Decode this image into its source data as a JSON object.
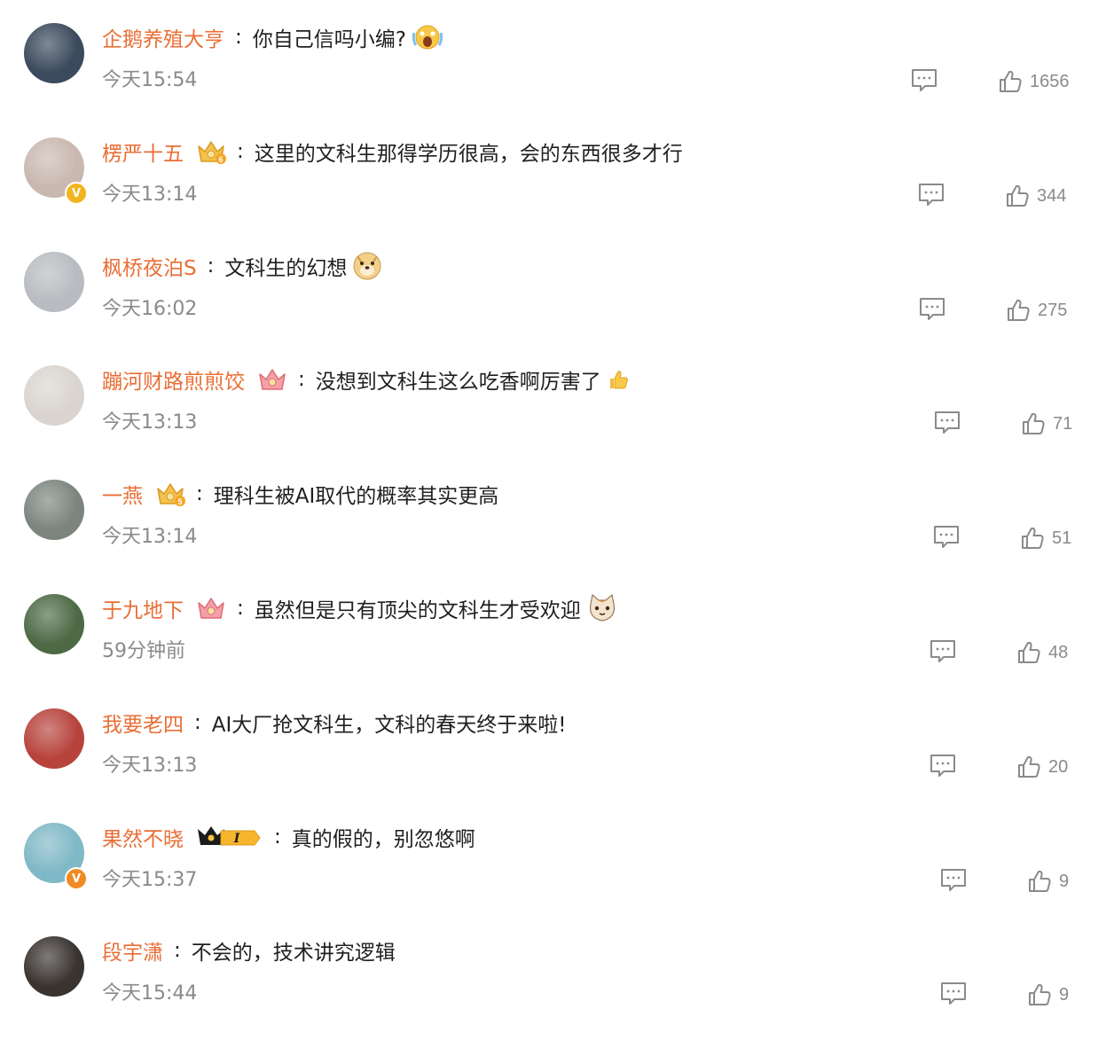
{
  "comments": [
    {
      "user": "企鹅养殖大亨",
      "text": "你自己信吗小编?",
      "time": "今天15:54",
      "likes": "1656",
      "verified": false,
      "crown": "none",
      "emoji": "scream-emoji",
      "avatar_color": "#3b4a5c"
    },
    {
      "user": "楞严十五",
      "text": "这里的文科生那得学历很高，会的东西很多才行",
      "time": "今天13:14",
      "likes": "344",
      "verified": true,
      "verified_color": "#f2b51d",
      "crown": "gold-crown-6",
      "emoji": "",
      "avatar_color": "#c9b8b0"
    },
    {
      "user": "枫桥夜泊S",
      "text": "文科生的幻想",
      "time": "今天16:02",
      "likes": "275",
      "verified": false,
      "crown": "none",
      "emoji": "doge-emoji",
      "avatar_color": "#b8bcc0"
    },
    {
      "user": "蹦河财路煎煎饺",
      "text": "没想到文科生这么吃香啊厉害了",
      "time": "今天13:13",
      "likes": "71",
      "verified": false,
      "crown": "pink-crown",
      "emoji": "thumbs-up-emoji",
      "avatar_color": "#d9d4cf"
    },
    {
      "user": "一燕",
      "text": "理科生被AI取代的概率其实更高",
      "time": "今天13:14",
      "likes": "51",
      "verified": false,
      "crown": "gold-crown-5",
      "emoji": "",
      "avatar_color": "#7b857e"
    },
    {
      "user": "于九地下",
      "text": "虽然但是只有顶尖的文科生才受欢迎",
      "time": "59分钟前",
      "likes": "48",
      "verified": false,
      "crown": "pink-crown",
      "emoji": "cat-emoji",
      "avatar_color": "#4d6a45"
    },
    {
      "user": "我要老四",
      "text": "AI大厂抢文科生，文科的春天终于来啦!",
      "time": "今天13:13",
      "likes": "20",
      "verified": false,
      "crown": "none",
      "emoji": "",
      "avatar_color": "#b8433d"
    },
    {
      "user": "果然不晓",
      "text": "真的假的，别忽悠啊",
      "time": "今天15:37",
      "likes": "9",
      "verified": true,
      "verified_color": "#f08a24",
      "crown": "vip-crown-I",
      "emoji": "",
      "avatar_color": "#7fb8c6"
    },
    {
      "user": "段宇潇",
      "text": "不会的，技术讲究逻辑",
      "time": "今天15:44",
      "likes": "9",
      "verified": false,
      "crown": "none",
      "emoji": "",
      "avatar_color": "#3a3430"
    }
  ],
  "colors": {
    "username": "#e96e35",
    "text": "#1f1f1f",
    "meta": "#8a8a8a",
    "icon": "#8a8a8a"
  },
  "icons": {
    "reply": "comment-bubble-icon",
    "like": "thumbs-up-icon"
  }
}
